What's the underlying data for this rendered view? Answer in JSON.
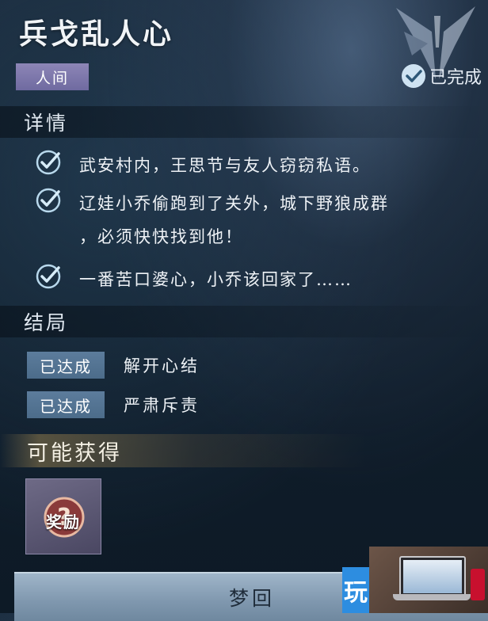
{
  "quest": {
    "title": "兵戈乱人心",
    "realm_tag": "人间",
    "status": "已完成"
  },
  "details": {
    "heading": "详情",
    "tasks": [
      {
        "lines": [
          "武安村内，王思节与友人窃窃私语。"
        ]
      },
      {
        "lines": [
          "辽娃小乔偷跑到了关外，城下野狼成群",
          "，必须快快找到他！"
        ]
      },
      {
        "lines": [
          "一番苦口婆心，小乔该回家了……"
        ]
      }
    ]
  },
  "endings": {
    "heading": "结局",
    "items": [
      {
        "badge": "已达成",
        "label": "解开心结"
      },
      {
        "badge": "已达成",
        "label": "严肃斥责"
      }
    ]
  },
  "rewards": {
    "heading": "可能获得",
    "item_text": "奖励"
  },
  "footer": {
    "button_label": "梦回"
  },
  "watermark": {
    "char": "玩"
  },
  "colors": {
    "realm_tag_bg": "#7a74aa",
    "ending_badge_bg": "#56768f",
    "check_color": "#b8d8ec",
    "reward_glow": "#a88c50"
  }
}
